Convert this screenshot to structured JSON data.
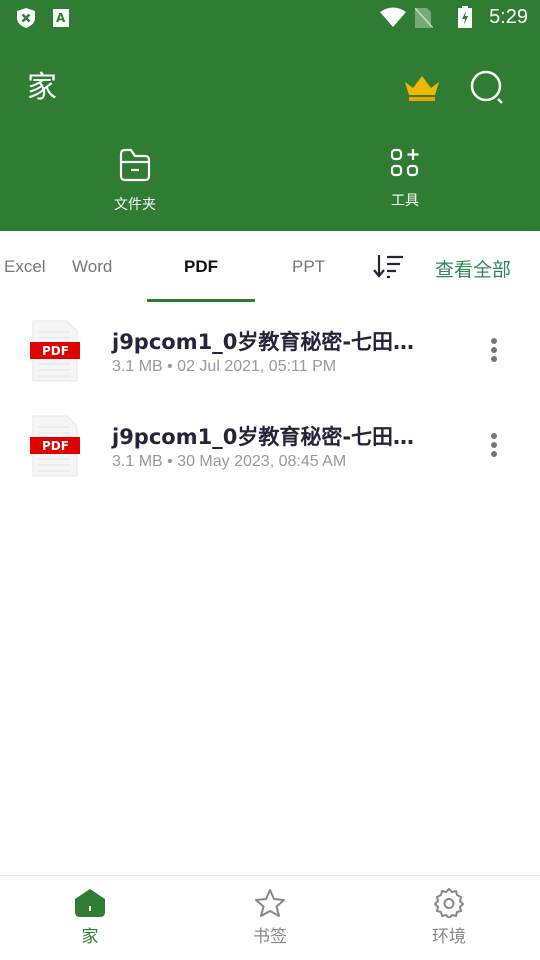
{
  "status": {
    "time": "5:29"
  },
  "header": {
    "title": "家",
    "quick_actions": [
      {
        "label": "文件夹",
        "icon": "folder-icon"
      },
      {
        "label": "工具",
        "icon": "tools-icon"
      }
    ]
  },
  "tabs": {
    "items": [
      "Excel",
      "Word",
      "PDF",
      "PPT"
    ],
    "active": "PDF",
    "view_all": "查看全部"
  },
  "files": [
    {
      "name": "j9pcom1_0岁教育秘密-七田…",
      "meta": "3.1 MB • 02 Jul 2021, 05:11 PM",
      "type": "PDF"
    },
    {
      "name": "j9pcom1_0岁教育秘密-七田…",
      "meta": "3.1 MB • 30 May 2023, 08:45 AM",
      "type": "PDF"
    }
  ],
  "bottom_nav": [
    {
      "label": "家",
      "active": true
    },
    {
      "label": "书签"
    },
    {
      "label": "环境"
    }
  ],
  "colors": {
    "primary": "#2e7d32",
    "crown": "#f2b705",
    "pdf_red": "#e00000",
    "view_all": "#2e8b57"
  }
}
